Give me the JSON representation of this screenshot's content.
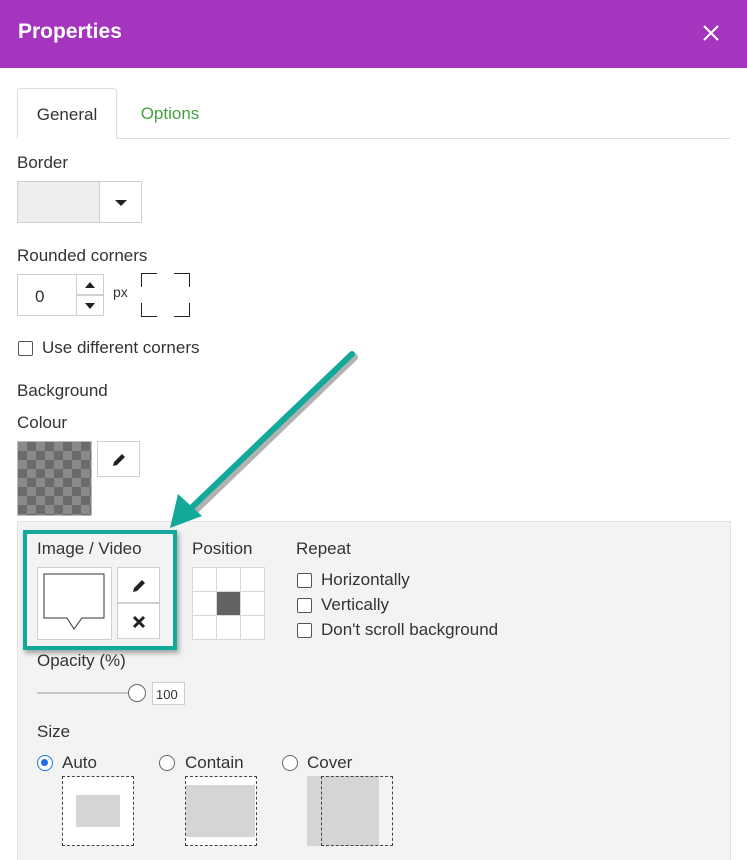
{
  "header": {
    "title": "Properties",
    "close_icon": "close-icon",
    "background": "#a535bf"
  },
  "tabs": [
    {
      "label": "General",
      "active": true
    },
    {
      "label": "Options",
      "active": false
    }
  ],
  "border": {
    "label": "Border",
    "dropdown_icon": "caret-down-icon"
  },
  "rounded_corners": {
    "label": "Rounded corners",
    "value": "0",
    "unit": "px"
  },
  "use_different_corners": {
    "label": "Use different corners",
    "checked": false
  },
  "background": {
    "label": "Background",
    "colour_label": "Colour",
    "edit_icon": "pencil-icon",
    "image_video": {
      "label": "Image / Video",
      "edit_icon": "pencil-icon",
      "remove_icon": "x-icon"
    },
    "position": {
      "label": "Position",
      "selected": "center"
    },
    "repeat": {
      "label": "Repeat",
      "options": [
        {
          "label": "Horizontally",
          "checked": false
        },
        {
          "label": "Vertically",
          "checked": false
        },
        {
          "label": "Don't scroll background",
          "checked": false
        }
      ]
    },
    "opacity": {
      "label": "Opacity (%)",
      "value": "100"
    },
    "size": {
      "label": "Size",
      "options": [
        {
          "label": "Auto",
          "selected": true
        },
        {
          "label": "Contain",
          "selected": false
        },
        {
          "label": "Cover",
          "selected": false
        }
      ]
    }
  },
  "colors": {
    "accent_green": "#4aa03f",
    "highlight": "#12a89a",
    "radio_blue": "#1a6fe0"
  }
}
